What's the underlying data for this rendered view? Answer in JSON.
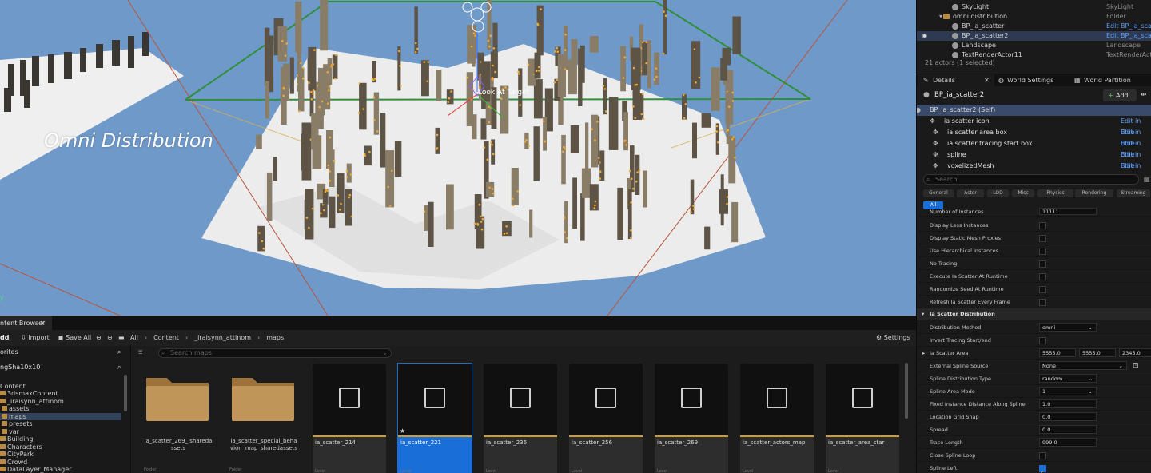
{
  "viewport": {
    "title": "Omni Distribution",
    "target_label": "Look At Target",
    "y_axis": "y"
  },
  "outliner": {
    "rows": [
      {
        "name": "SkyLight",
        "type": "SkyLight",
        "link": false,
        "selected": false,
        "icon": "skylight-icon"
      },
      {
        "name": "omni distribution",
        "type": "Folder",
        "link": false,
        "selected": false,
        "icon": "folder-icon"
      },
      {
        "name": "BP_ia_scatter",
        "type": "Edit BP_ia_scatt",
        "link": true,
        "selected": false,
        "icon": "blueprint-icon"
      },
      {
        "name": "BP_ia_scatter2",
        "type": "Edit BP_ia_scatt",
        "link": true,
        "selected": true,
        "icon": "blueprint-icon"
      },
      {
        "name": "Landscape",
        "type": "Landscape",
        "link": false,
        "selected": false,
        "icon": "landscape-icon"
      },
      {
        "name": "TextRenderActor11",
        "type": "TextRenderActor",
        "link": false,
        "selected": false,
        "icon": "text-icon"
      }
    ],
    "status": "21 actors (1 selected)"
  },
  "tabs": {
    "details": "Details",
    "world_settings": "World Settings",
    "world_partition": "World Partition"
  },
  "details": {
    "actor_name": "BP_ia_scatter2",
    "add_label": "Add",
    "components": [
      {
        "name": "BP_ia_scatter2 (Self)",
        "edit": ""
      },
      {
        "name": "ia scatter icon",
        "edit": "Edit in Blue"
      },
      {
        "name": "ia scatter area box",
        "edit": "Edit in Blue"
      },
      {
        "name": "ia scatter tracing start box",
        "edit": "Edit in Blue"
      },
      {
        "name": "spline",
        "edit": "Edit in Blue"
      },
      {
        "name": "voxelizedMesh",
        "edit": "Edit in Blue"
      }
    ],
    "search_placeholder": "Search",
    "categories": [
      "General",
      "Actor",
      "LOD",
      "Misc",
      "Physics",
      "Rendering",
      "Streaming",
      "All"
    ],
    "partial_row": {
      "label": "Number of Instances",
      "value": "11111"
    },
    "bool_props": [
      {
        "label": "Display Less Instances",
        "checked": false
      },
      {
        "label": "Display Static Mesh Proxies",
        "checked": false
      },
      {
        "label": "Use Hierarchical Instances",
        "checked": false
      },
      {
        "label": "No Tracing",
        "checked": false
      },
      {
        "label": "Execute Ia Scatter At Runtime",
        "checked": false
      },
      {
        "label": "Randomize Seed At Runtime",
        "checked": false
      },
      {
        "label": "Refresh Ia Scatter Every Frame",
        "checked": false
      }
    ],
    "section": "Ia Scatter Distribution",
    "distribution_method": {
      "label": "Distribution Method",
      "value": "omni"
    },
    "invert_tracing": {
      "label": "Invert Tracing Start/end",
      "checked": false
    },
    "scatter_area": {
      "label": "Ia Scatter Area",
      "x": "5555.0",
      "y": "5555.0",
      "z": "2345.0"
    },
    "external_spline": {
      "label": "External Spline Source",
      "value": "None"
    },
    "spline_distribution": {
      "label": "Spline Distribution Type",
      "value": "random"
    },
    "spline_area_mode": {
      "label": "Spline Area Mode",
      "value": "1"
    },
    "fixed_distance": {
      "label": "Fixed Instance Distance Along Spline",
      "value": "1.0"
    },
    "location_grid_snap": {
      "label": "Location Grid Snap",
      "value": "0.0"
    },
    "spread": {
      "label": "Spread",
      "value": "0.0"
    },
    "trace_length": {
      "label": "Trace Length",
      "value": "999.0"
    },
    "close_spline_loop": {
      "label": "Close Spline Loop",
      "checked": false
    },
    "spline_left": {
      "label": "Spline Left",
      "checked": true
    }
  },
  "content_browser": {
    "tab": "ntent Browser",
    "add": "dd",
    "import": "Import",
    "save_all": "Save All",
    "breadcrumb": [
      "All",
      "Content",
      "_iraisynn_attinom",
      "maps"
    ],
    "settings": "Settings",
    "favorites": "orites",
    "project": "ngSha10x10",
    "search_placeholder": "Search maps",
    "tree": [
      {
        "label": "",
        "indent": 0,
        "selected": false,
        "folder": false
      },
      {
        "label": "Content",
        "indent": 0,
        "selected": false,
        "folder": false
      },
      {
        "label": "3dsmaxContent",
        "indent": 1,
        "selected": false,
        "folder": true
      },
      {
        "label": "_iraisynn_attinom",
        "indent": 1,
        "selected": false,
        "folder": true
      },
      {
        "label": "assets",
        "indent": 2,
        "selected": false,
        "folder": true
      },
      {
        "label": "maps",
        "indent": 2,
        "selected": true,
        "folder": true
      },
      {
        "label": "presets",
        "indent": 2,
        "selected": false,
        "folder": true
      },
      {
        "label": "var",
        "indent": 2,
        "selected": false,
        "folder": true
      },
      {
        "label": "Building",
        "indent": 1,
        "selected": false,
        "folder": true
      },
      {
        "label": "Characters",
        "indent": 1,
        "selected": false,
        "folder": true
      },
      {
        "label": "CityPark",
        "indent": 1,
        "selected": false,
        "folder": true
      },
      {
        "label": "Crowd",
        "indent": 1,
        "selected": false,
        "folder": true
      },
      {
        "label": "DataLayer_Manager",
        "indent": 1,
        "selected": false,
        "folder": true
      }
    ],
    "assets": [
      {
        "name": "ia_scatter_269_ sharedassets",
        "kind": "folder",
        "selected": false,
        "type": "Folder"
      },
      {
        "name": "ia_scatter_special_behavior _map_sharedassets",
        "kind": "folder",
        "selected": false,
        "type": "Folder"
      },
      {
        "name": "ia_scatter_214",
        "kind": "level",
        "selected": false,
        "type": "Level"
      },
      {
        "name": "ia_scatter_221",
        "kind": "level",
        "selected": true,
        "type": "Level"
      },
      {
        "name": "ia_scatter_236",
        "kind": "level",
        "selected": false,
        "type": "Level"
      },
      {
        "name": "ia_scatter_256",
        "kind": "level",
        "selected": false,
        "type": "Level"
      },
      {
        "name": "ia_scatter_269",
        "kind": "level",
        "selected": false,
        "type": "Level"
      },
      {
        "name": "ia_scatter_actors_map",
        "kind": "level",
        "selected": false,
        "type": "Level"
      },
      {
        "name": "ia_scatter_area_star",
        "kind": "level",
        "selected": false,
        "type": "Level"
      }
    ]
  },
  "colors": {
    "sky": "#6f99c9",
    "selection": "#1a6ed8",
    "link": "#5aa0ff",
    "folder": "#b88a46",
    "level_accent": "#d19a32"
  }
}
